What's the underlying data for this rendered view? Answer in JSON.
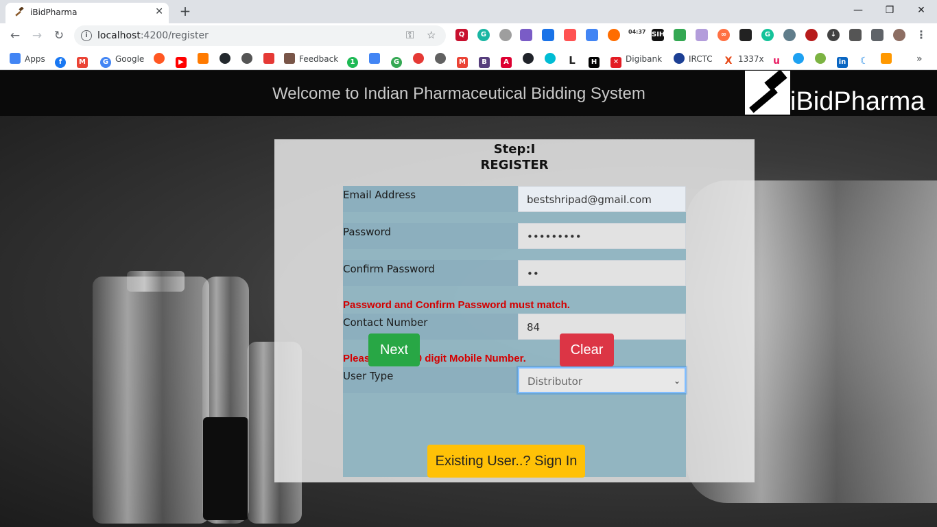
{
  "browser": {
    "tab_title": "iBidPharma",
    "tab_close": "✕",
    "new_tab": "+",
    "url_host": "localhost",
    "url_path": ":4200/register",
    "window": {
      "minimize": "—",
      "restore": "❐",
      "close": "✕"
    },
    "bookmarks": [
      "Apps",
      "Google",
      "Feedback",
      "Digibank",
      "IRCTC",
      "1337x"
    ],
    "clock_badge": "04:37"
  },
  "page": {
    "welcome": "Welcome to Indian Pharmaceutical Bidding System",
    "logo_text": "iBidPharma",
    "step": "Step:I",
    "heading": "REGISTER",
    "fields": {
      "email_label": "Email Address",
      "email_value": "bestshripad@gmail.com",
      "password_label": "Password",
      "password_value": "•••••••••",
      "confirm_label": "Confirm Password",
      "confirm_value": "••",
      "contact_label": "Contact Number",
      "contact_value": "84",
      "usertype_label": "User Type",
      "usertype_value": "Distributor"
    },
    "errors": {
      "password_mismatch": "Password and Confirm Password must match.",
      "mobile_invalid": "Please, Enter 10 digit Mobile Number."
    },
    "buttons": {
      "next": "Next",
      "clear": "Clear",
      "signin": "Existing User..? Sign In"
    }
  }
}
